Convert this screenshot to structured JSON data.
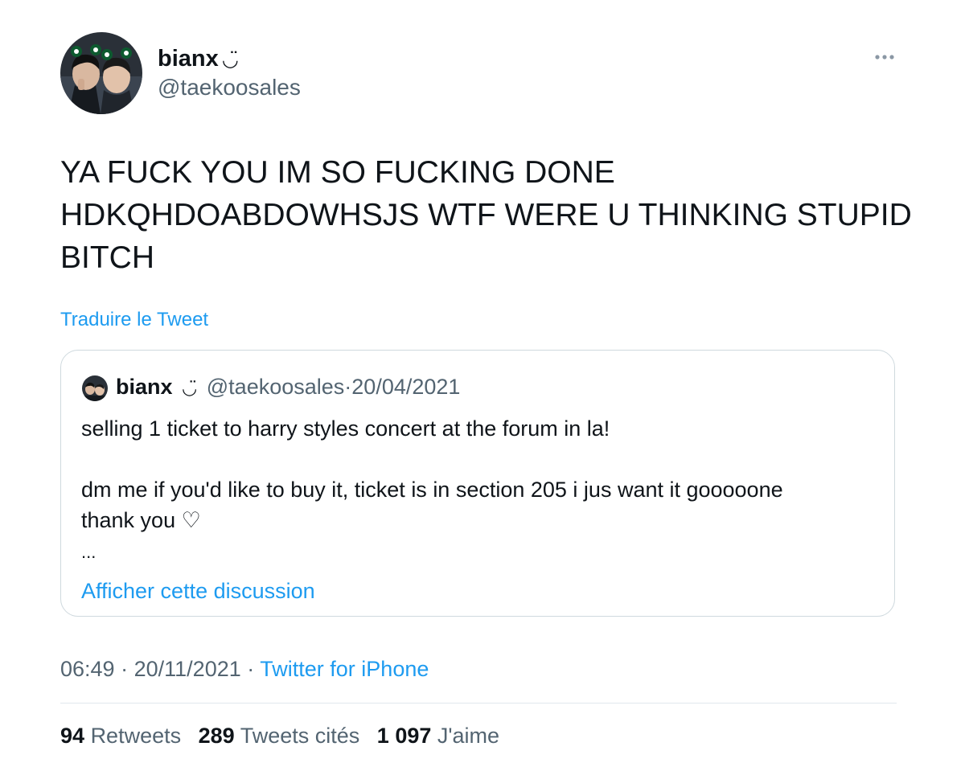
{
  "tweet": {
    "author": {
      "display_name": "bianx",
      "name_emoji": "◡̈",
      "handle": "@taekoosales",
      "avatar_icon": "profile-photo-two-people"
    },
    "more_icon": "more-horizontal-icon",
    "text": "YA FUCK YOU IM SO FUCKING DONE\nHDKQHDOABDOWHSJS WTF WERE U THINKING STUPID\nBITCH",
    "translate_label": "Traduire le Tweet",
    "quoted": {
      "display_name": "bianx",
      "name_emoji": "◡̈",
      "handle": "@taekoosales",
      "separator": "·",
      "date": "20/04/2021",
      "text": "selling 1 ticket to harry styles concert at the forum in la!\n\ndm me if you'd like to buy it, ticket is in section 205 i jus want it gooooone\nthank you ♡",
      "ellipsis": "...",
      "show_thread_label": "Afficher cette discussion"
    },
    "time": "06:49",
    "separator": "·",
    "date": "20/11/2021",
    "source": "Twitter for iPhone",
    "stats": {
      "retweets_count": "94",
      "retweets_label": "Retweets",
      "quotes_count": "289",
      "quotes_label": "Tweets cités",
      "likes_count": "1 097",
      "likes_label": "J'aime"
    },
    "colors": {
      "link": "#1d9bf0",
      "secondary_text": "#536471",
      "primary_text": "#0f1419",
      "border": "#cfd9de"
    }
  }
}
